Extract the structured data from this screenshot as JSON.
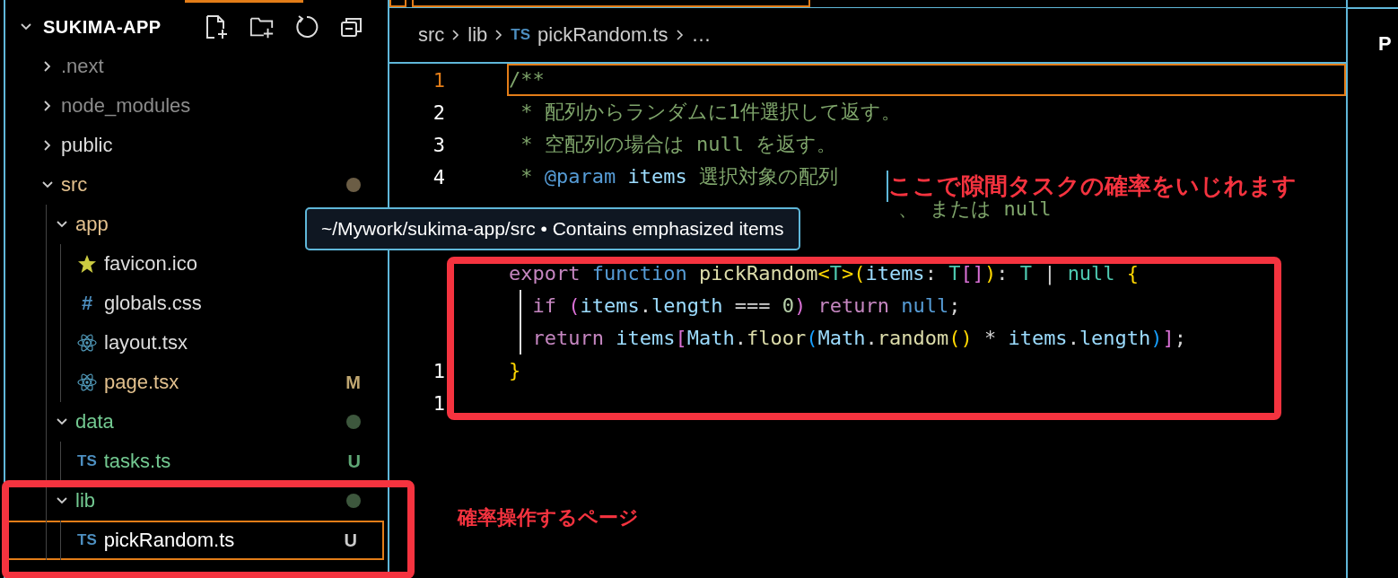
{
  "explorer": {
    "title": "SUKIMA-APP",
    "tree": [
      {
        "label": ".next",
        "kind": "folder",
        "expanded": false,
        "selected": false,
        "color": "#8c8c8c"
      },
      {
        "label": "node_modules",
        "kind": "folder",
        "expanded": false,
        "selected": false,
        "color": "#8c8c8c"
      },
      {
        "label": "public",
        "kind": "folder",
        "expanded": false,
        "selected": false,
        "color": "#dddddd"
      },
      {
        "label": "src",
        "kind": "folder",
        "expanded": true,
        "selected": false,
        "color": "#e2c08d",
        "dot": {
          "color": "#6b5d45"
        },
        "children": [
          {
            "label": "app",
            "kind": "folder",
            "expanded": true,
            "selected": false,
            "color": "#e2c08d",
            "children": [
              {
                "label": "favicon.ico",
                "kind": "star",
                "selected": false,
                "color": "#dddddd"
              },
              {
                "label": "globals.css",
                "kind": "hash",
                "icon_text": "#",
                "selected": false,
                "color": "#dddddd"
              },
              {
                "label": "layout.tsx",
                "kind": "react",
                "selected": false,
                "color": "#dddddd"
              },
              {
                "label": "page.tsx",
                "kind": "react",
                "selected": false,
                "color": "#e2c08d",
                "badge": {
                  "text": "M",
                  "color": "#bfa670"
                }
              }
            ]
          },
          {
            "label": "data",
            "kind": "folder",
            "expanded": true,
            "selected": false,
            "color": "#73c991",
            "dot": {
              "color": "#3d573d"
            },
            "children": [
              {
                "label": "tasks.ts",
                "kind": "ts",
                "icon_text": "TS",
                "selected": false,
                "color": "#73c991",
                "badge": {
                  "text": "U",
                  "color": "#5fa876"
                }
              }
            ]
          },
          {
            "label": "lib",
            "kind": "folder",
            "expanded": true,
            "selected": false,
            "color": "#73c991",
            "dot": {
              "color": "#3d573d"
            },
            "children": [
              {
                "label": "pickRandom.ts",
                "kind": "ts",
                "icon_text": "TS",
                "selected": true,
                "color": "#ffffff",
                "badge": {
                  "text": "U",
                  "color": "#cccccc"
                }
              }
            ]
          }
        ]
      }
    ]
  },
  "breadcrumb": [
    {
      "label": "src"
    },
    {
      "label": "lib"
    },
    {
      "label": "pickRandom.ts",
      "icon_text": "TS"
    },
    {
      "label": "…"
    }
  ],
  "editor": {
    "lines": [
      {
        "number": "1",
        "current": true,
        "tokens": [
          {
            "text": "/**",
            "kind": "comment"
          }
        ]
      },
      {
        "number": "2",
        "tokens": [
          {
            "text": " * 配列からランダムに1件選択して返す。",
            "kind": "comment"
          }
        ]
      },
      {
        "number": "3",
        "tokens": [
          {
            "text": " * 空配列の場合は null を返す。",
            "kind": "comment"
          }
        ]
      },
      {
        "number": "4",
        "tokens": [
          {
            "text": " * ",
            "kind": "comment"
          },
          {
            "text": "@param ",
            "kind": "tag"
          },
          {
            "text": "items ",
            "kind": "var"
          },
          {
            "text": "選択対象の配列",
            "kind": "comment"
          }
        ]
      },
      {
        "under_tooltip": true,
        "tokens": [
          {
            "text": "、 または null",
            "kind": "comment"
          }
        ]
      },
      {
        "tokens": [
          {
            "text": "export ",
            "kind": "kw"
          },
          {
            "text": "function ",
            "kind": "storage"
          },
          {
            "text": "pickRandom",
            "kind": "fn"
          },
          {
            "text": "<",
            "kind": "bracket1"
          },
          {
            "text": "T",
            "kind": "type"
          },
          {
            "text": ">",
            "kind": "bracket1"
          },
          {
            "text": "(",
            "kind": "bracket1"
          },
          {
            "text": "items",
            "kind": "var"
          },
          {
            "text": ": ",
            "kind": "punct"
          },
          {
            "text": "T",
            "kind": "type"
          },
          {
            "text": "[]",
            "kind": "bracket2"
          },
          {
            "text": ")",
            "kind": "bracket1"
          },
          {
            "text": ": ",
            "kind": "punct"
          },
          {
            "text": "T ",
            "kind": "type"
          },
          {
            "text": "| ",
            "kind": "punct"
          },
          {
            "text": "null ",
            "kind": "type"
          },
          {
            "text": "{",
            "kind": "bracket1"
          }
        ]
      },
      {
        "guide": true,
        "tokens": [
          {
            "text": "  if ",
            "kind": "kw"
          },
          {
            "text": "(",
            "kind": "bracket2"
          },
          {
            "text": "items",
            "kind": "var"
          },
          {
            "text": ".",
            "kind": "punct"
          },
          {
            "text": "length ",
            "kind": "var"
          },
          {
            "text": "=== ",
            "kind": "punct"
          },
          {
            "text": "0",
            "kind": "num"
          },
          {
            "text": ") ",
            "kind": "bracket2"
          },
          {
            "text": "return ",
            "kind": "kw"
          },
          {
            "text": "null",
            "kind": "storage"
          },
          {
            "text": ";",
            "kind": "punct"
          }
        ]
      },
      {
        "guide": true,
        "tokens": [
          {
            "text": "  return ",
            "kind": "kw"
          },
          {
            "text": "items",
            "kind": "var"
          },
          {
            "text": "[",
            "kind": "bracket2"
          },
          {
            "text": "Math",
            "kind": "var"
          },
          {
            "text": ".",
            "kind": "punct"
          },
          {
            "text": "floor",
            "kind": "fn"
          },
          {
            "text": "(",
            "kind": "bracket3"
          },
          {
            "text": "Math",
            "kind": "var"
          },
          {
            "text": ".",
            "kind": "punct"
          },
          {
            "text": "random",
            "kind": "fn"
          },
          {
            "text": "() ",
            "kind": "bracket1"
          },
          {
            "text": "* ",
            "kind": "punct"
          },
          {
            "text": "items",
            "kind": "var"
          },
          {
            "text": ".",
            "kind": "punct"
          },
          {
            "text": "length",
            "kind": "var"
          },
          {
            "text": ")",
            "kind": "bracket3"
          },
          {
            "text": "]",
            "kind": "bracket2"
          },
          {
            "text": ";",
            "kind": "punct"
          }
        ]
      },
      {
        "number": "1",
        "tokens": [
          {
            "text": "}",
            "kind": "bracket1"
          }
        ]
      },
      {
        "number": "1"
      }
    ]
  },
  "tooltip": "~/Mywork/sukima-app/src • Contains emphasized items",
  "side_panel": {
    "title": "P"
  },
  "annotations": [
    {
      "kind": "code_frame"
    },
    {
      "kind": "file_frame"
    },
    {
      "kind": "code_note",
      "text": "ここで隙間タスクの確率をいじれます"
    },
    {
      "kind": "file_note",
      "text": "確率操作するページ"
    }
  ]
}
